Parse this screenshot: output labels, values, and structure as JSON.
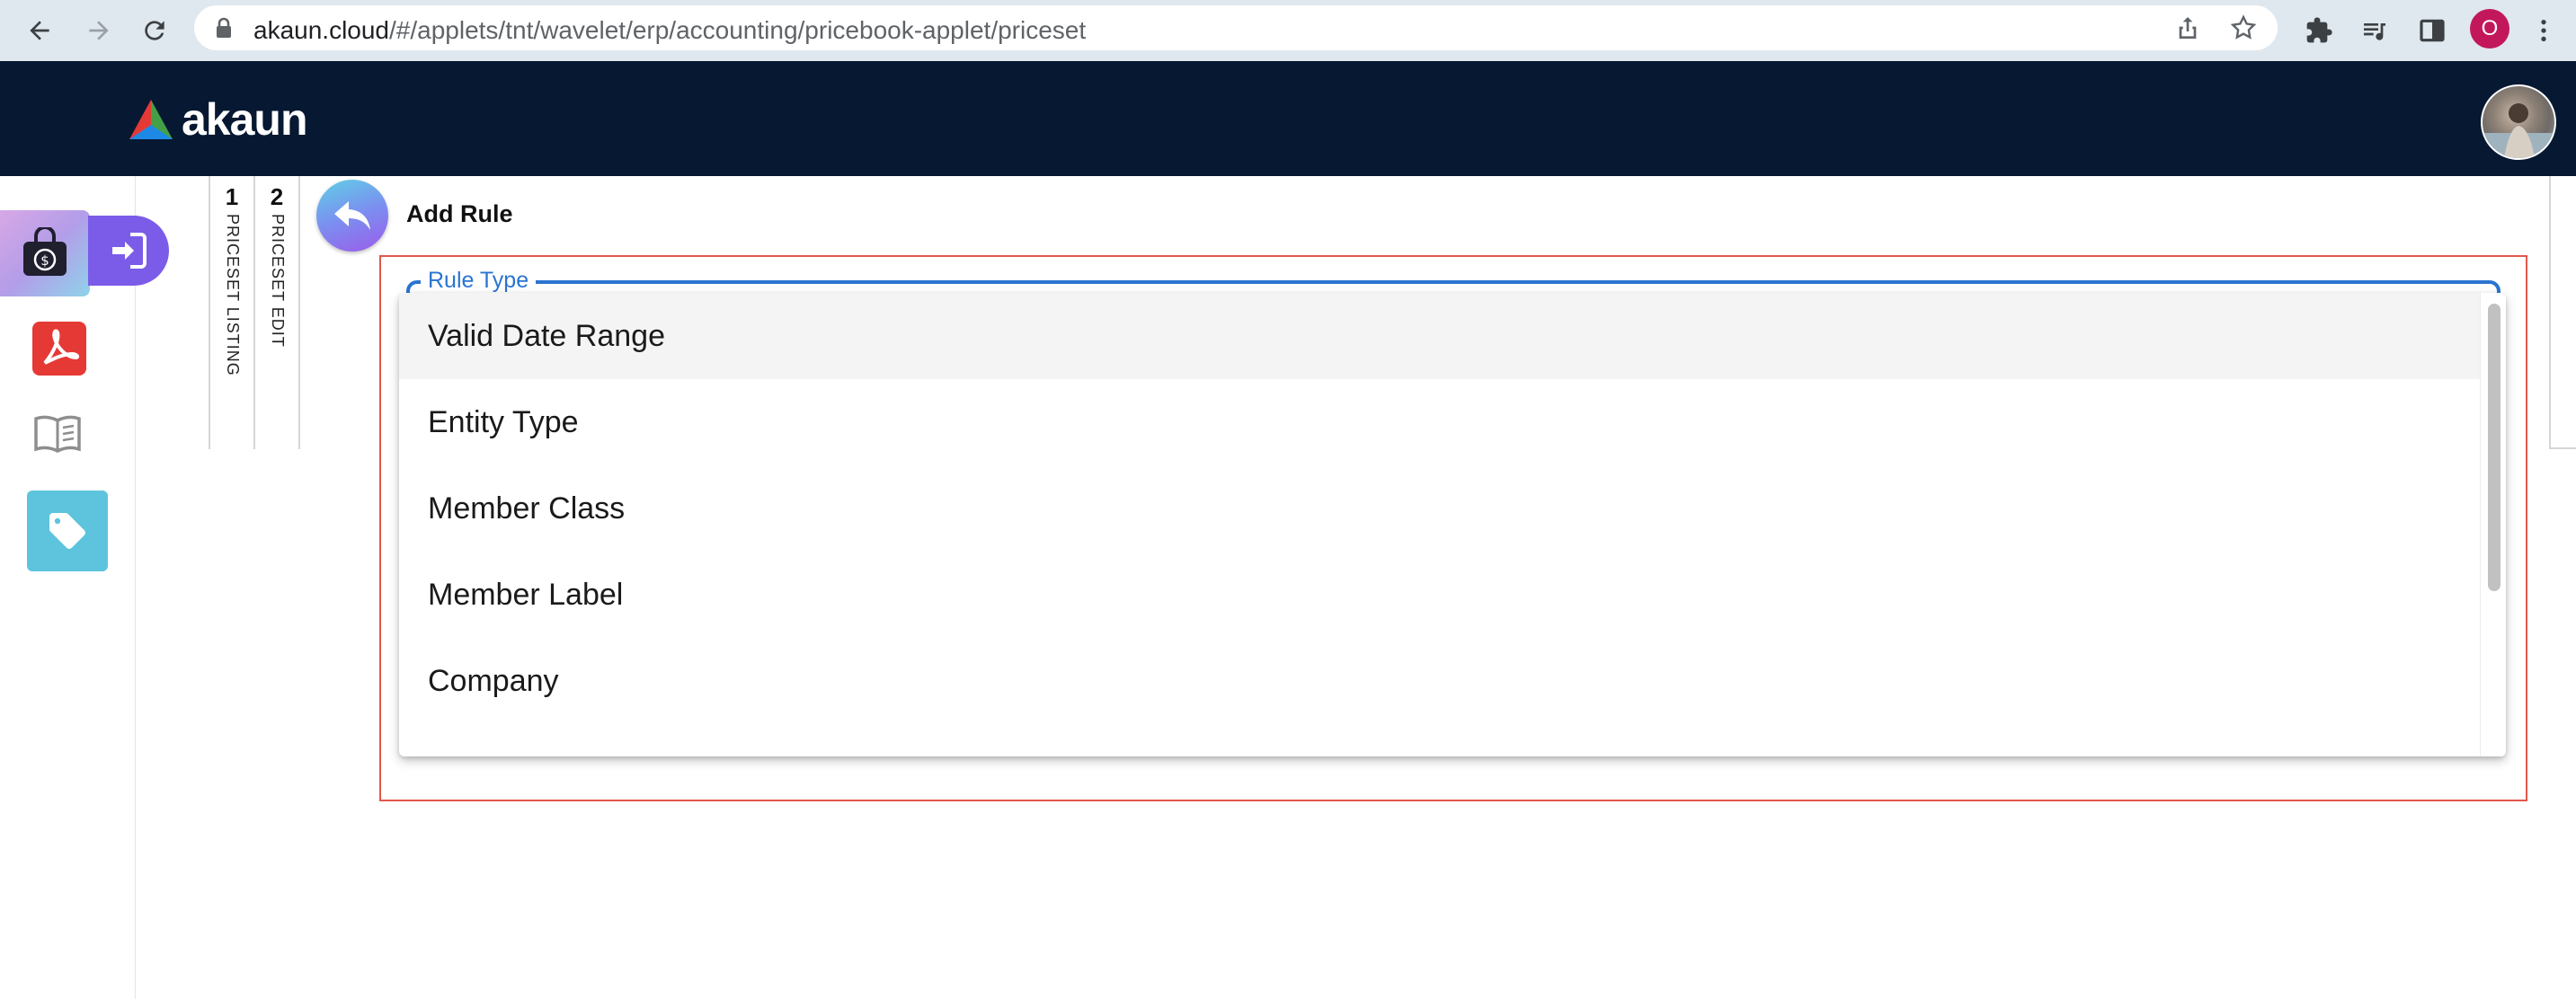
{
  "browser": {
    "url_host": "akaun.cloud",
    "url_path": "/#/applets/tnt/wavelet/erp/accounting/pricebook-applet/priceset",
    "profile_initial": "O"
  },
  "header": {
    "logo_text": "akaun"
  },
  "steps": [
    {
      "number": "1",
      "label": "PRICESET LISTING"
    },
    {
      "number": "2",
      "label": "PRICESET EDIT"
    }
  ],
  "panel": {
    "title": "Add Rule",
    "field_label": "Rule Type"
  },
  "dropdown": {
    "options": [
      "Valid Date Range",
      "Entity Type",
      "Member Class",
      "Member Label",
      "Company"
    ],
    "highlighted_index": 0
  },
  "colors": {
    "header_bg": "#061832",
    "accent_blue": "#2a74d0",
    "error_red": "#e2574c",
    "tag_tile": "#5ec4dd"
  }
}
